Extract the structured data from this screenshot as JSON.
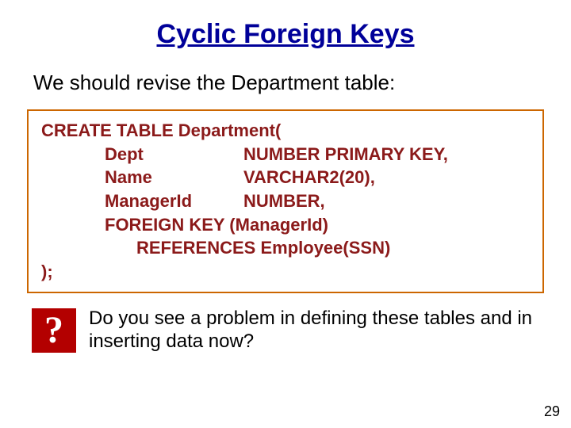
{
  "title": "Cyclic Foreign Keys",
  "intro": "We should revise the Department table:",
  "code": {
    "l1": "CREATE TABLE Department(",
    "l2a": "Dept",
    "l2b": "NUMBER PRIMARY KEY,",
    "l3a": "Name",
    "l3b": "VARCHAR2(20),",
    "l4a": "ManagerId",
    "l4b": "NUMBER,",
    "l5": "FOREIGN KEY (ManagerId)",
    "l6": "REFERENCES Employee(SSN)",
    "l7": ");"
  },
  "qmark": "?",
  "question": "Do you see a problem in defining these tables and in inserting data now?",
  "pagenum": "29"
}
